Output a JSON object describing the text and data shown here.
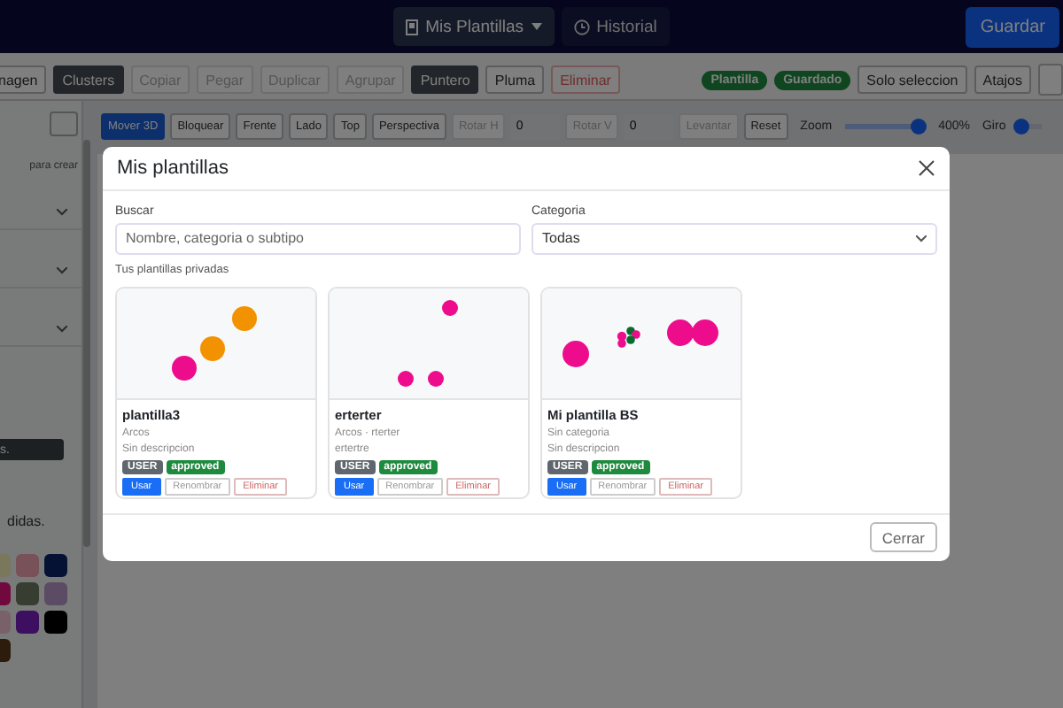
{
  "topbar": {
    "templates_button": "Mis Plantillas",
    "history_button": "Historial",
    "save_button": "Guardar"
  },
  "toolbar": [
    {
      "label": "nagen",
      "active": false,
      "disabled": false
    },
    {
      "label": "Clusters",
      "active": true,
      "disabled": false
    },
    {
      "label": "Copiar",
      "active": false,
      "disabled": true
    },
    {
      "label": "Pegar",
      "active": false,
      "disabled": true
    },
    {
      "label": "Duplicar",
      "active": false,
      "disabled": true
    },
    {
      "label": "Agrupar",
      "active": false,
      "disabled": true
    },
    {
      "label": "Puntero",
      "active": true,
      "disabled": false
    },
    {
      "label": "Pluma",
      "active": false,
      "disabled": false
    },
    {
      "label": "Eliminar",
      "active": false,
      "disabled": true
    }
  ],
  "toolbar_right": [
    {
      "kind": "badge",
      "label": "Plantilla"
    },
    {
      "kind": "badge",
      "label": "Guardado"
    },
    {
      "kind": "button",
      "label": "Solo seleccion"
    },
    {
      "kind": "button",
      "label": "Atajos"
    }
  ],
  "view_bar": [
    {
      "kind": "button",
      "label": "Mover 3D",
      "active": true,
      "disabled": false
    },
    {
      "kind": "button",
      "label": "Bloquear",
      "active": false,
      "disabled": false
    },
    {
      "kind": "button",
      "label": "Frente",
      "active": false,
      "disabled": false
    },
    {
      "kind": "button",
      "label": "Lado",
      "active": false,
      "disabled": false
    },
    {
      "kind": "button",
      "label": "Top",
      "active": false,
      "disabled": false
    },
    {
      "kind": "button",
      "label": "Perspectiva",
      "active": false,
      "disabled": false
    },
    {
      "kind": "button",
      "label": "Rotar H",
      "active": false,
      "disabled": true
    },
    {
      "kind": "input",
      "value": "0"
    },
    {
      "kind": "button",
      "label": "Rotar V",
      "active": false,
      "disabled": true
    },
    {
      "kind": "input",
      "value": "0"
    },
    {
      "kind": "button",
      "label": "Levantar",
      "active": false,
      "disabled": true
    },
    {
      "kind": "button",
      "label": "Reset",
      "active": false,
      "disabled": false
    },
    {
      "kind": "slider",
      "label": "Zoom",
      "level": 1,
      "reading": "400%"
    },
    {
      "kind": "slider",
      "label": "Giro",
      "level": 0.1
    }
  ],
  "sidebar": {
    "hint": "para crear",
    "button": "s.",
    "note": "didas.",
    "swatches": [
      {
        "color": "#79775c"
      },
      {
        "color": "#795158"
      },
      {
        "color": "#061233"
      },
      {
        "color": "#71093f"
      },
      {
        "color": "#373d31"
      },
      {
        "color": "#5c4b64"
      },
      {
        "color": "#796169"
      },
      {
        "color": "#3d0f60"
      },
      {
        "color": "#000000"
      },
      {
        "color": "#2d1b0b"
      }
    ]
  },
  "modal": {
    "title": "Mis plantillas",
    "search": {
      "label": "Buscar",
      "placeholder": "Nombre, categoria o subtipo"
    },
    "category": {
      "label": "Categoria",
      "value": "Todas"
    },
    "section": "Tus plantillas privadas",
    "cards": [
      {
        "name": "plantilla3",
        "category": "Arcos",
        "description": "Sin descripcion",
        "badges": [
          "USER",
          "approved"
        ],
        "actions": [
          "Usar",
          "Renombrar",
          "Eliminar"
        ]
      },
      {
        "name": "erterter",
        "category": "Arcos · rterter",
        "description": "ertertre",
        "badges": [
          "USER",
          "approved"
        ],
        "actions": [
          "Usar",
          "Renombrar",
          "Eliminar"
        ]
      },
      {
        "name": "Mi plantilla BS",
        "category": "Sin categoria",
        "description": "Sin descripcion",
        "badges": [
          "USER",
          "approved"
        ],
        "actions": [
          "Usar",
          "Renombrar",
          "Eliminar"
        ]
      }
    ],
    "close_button": "Cerrar"
  }
}
